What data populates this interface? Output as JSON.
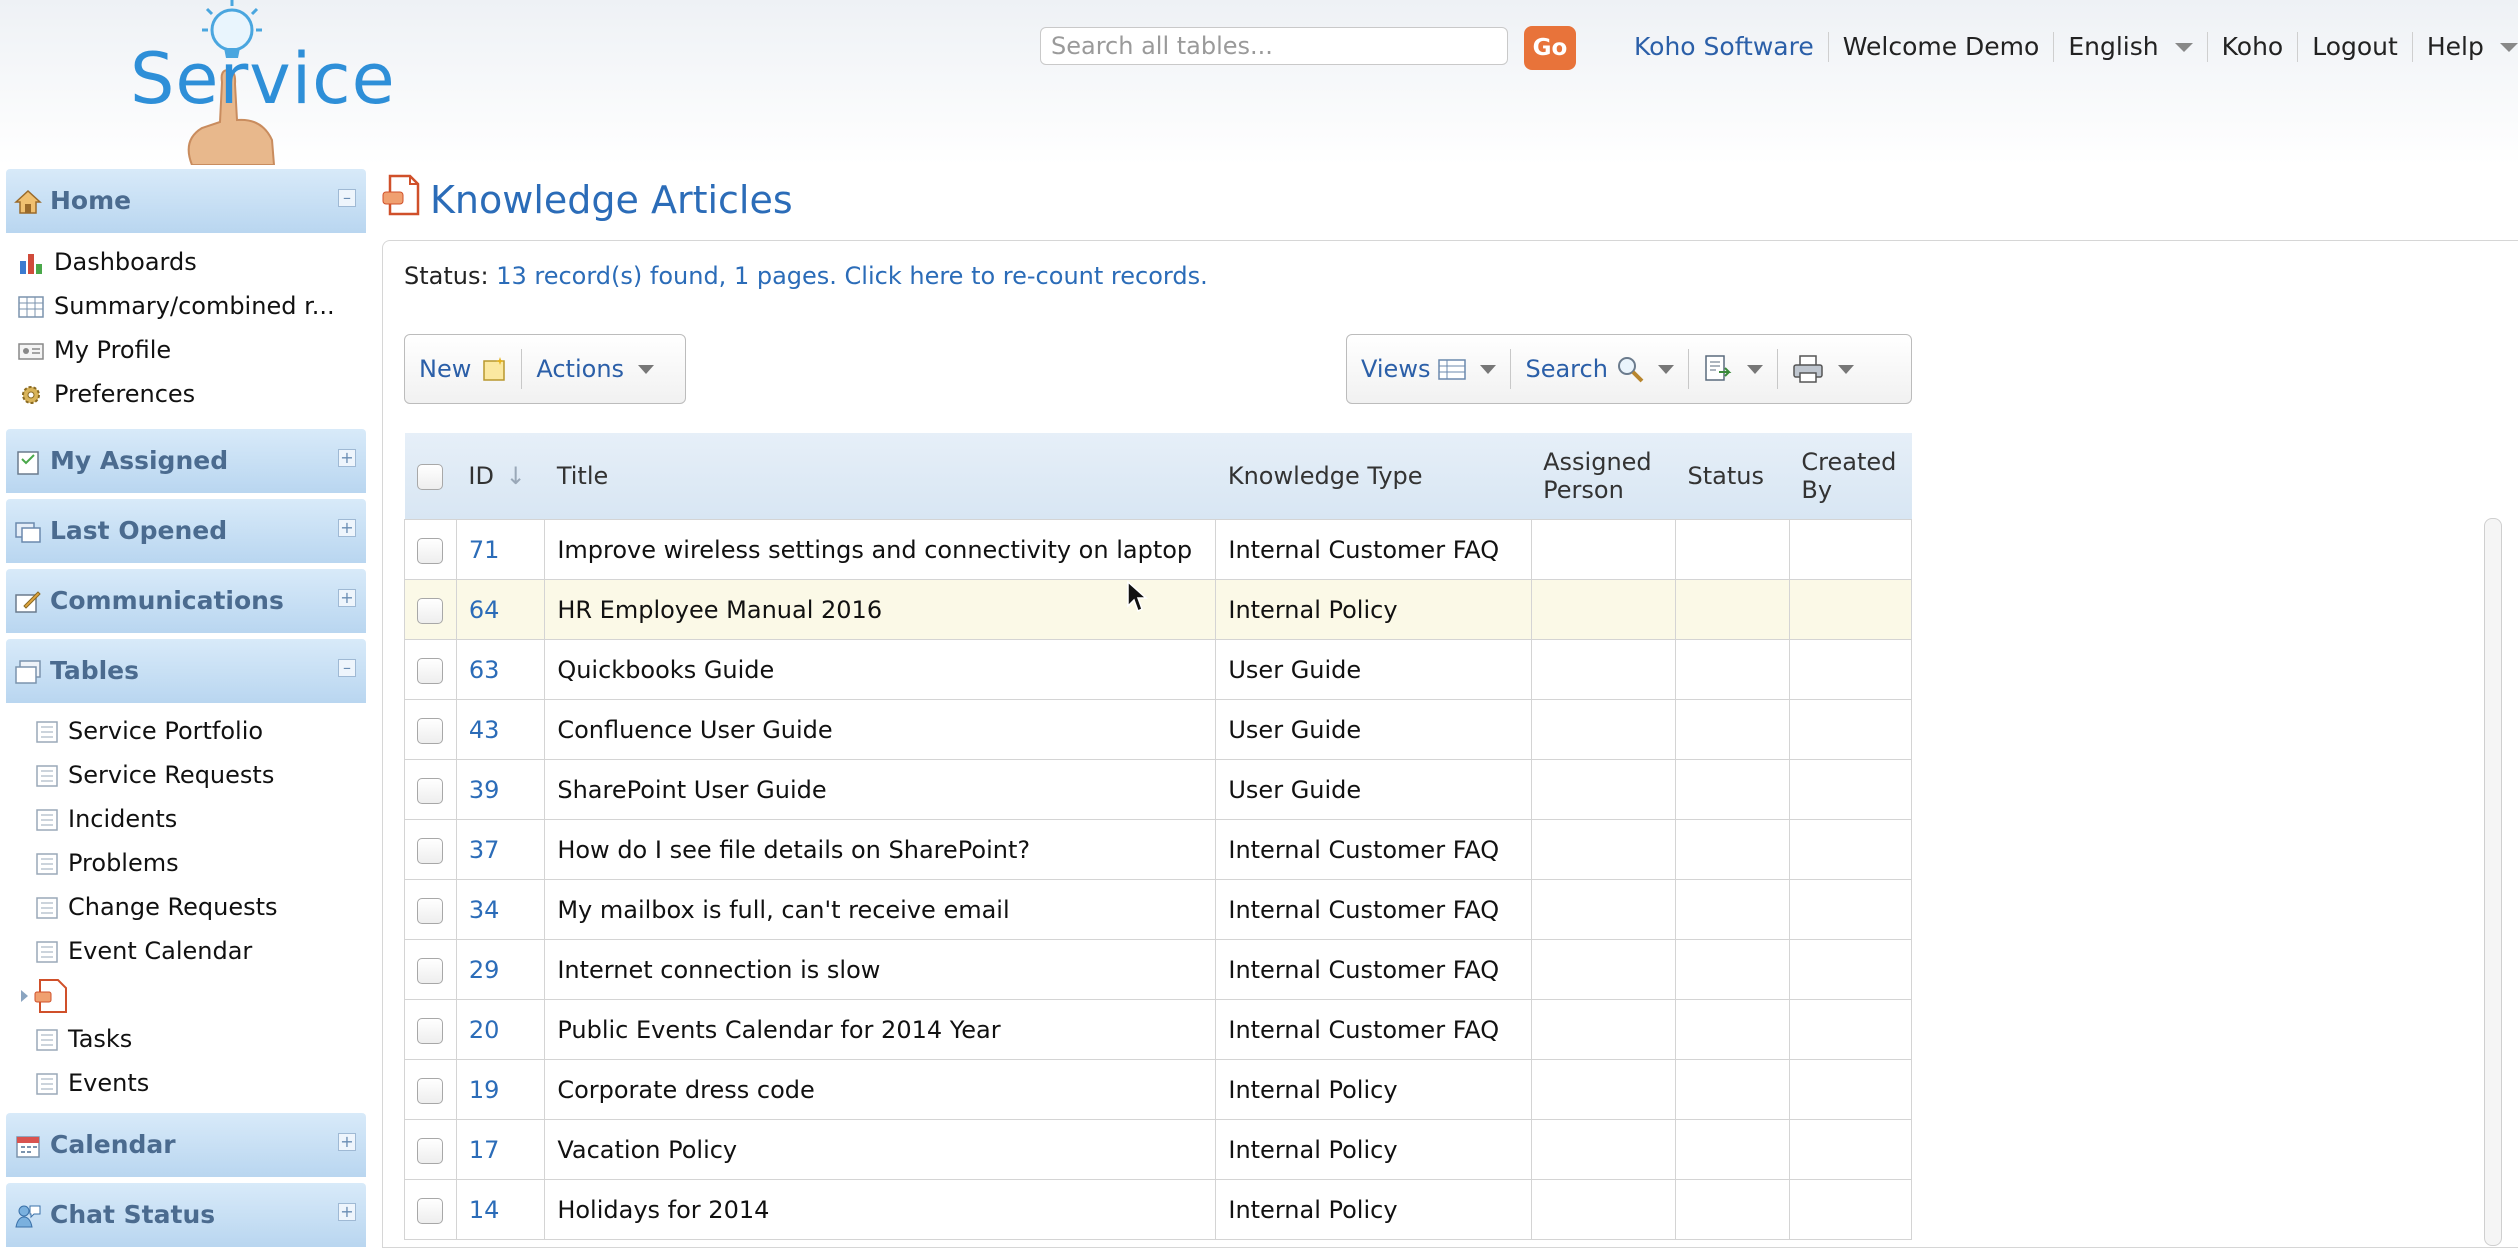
{
  "header": {
    "logo_text": "Service",
    "search_placeholder": "Search all tables...",
    "go_label": "Go",
    "nav": {
      "company": "Koho Software",
      "welcome": "Welcome Demo",
      "language": "English",
      "user": "Koho",
      "logout": "Logout",
      "help": "Help"
    }
  },
  "sidebar": {
    "home": {
      "label": "Home",
      "items": [
        "Dashboards",
        "Summary/combined r...",
        "My Profile",
        "Preferences"
      ]
    },
    "my_assigned": "My Assigned",
    "last_opened": "Last Opened",
    "communications": "Communications",
    "tables": {
      "label": "Tables",
      "items": [
        "Service Portfolio",
        "Service Requests",
        "Incidents",
        "Problems",
        "Change Requests",
        "Event Calendar",
        "Tasks",
        "Events"
      ]
    },
    "calendar": "Calendar",
    "chat_status": "Chat Status"
  },
  "main": {
    "title": "Knowledge Articles",
    "status_label": "Status:",
    "status_text": "13 record(s) found, 1 pages. Click here to re-count records.",
    "toolbar": {
      "new_label": "New",
      "actions_label": "Actions",
      "views_label": "Views",
      "search_label": "Search"
    },
    "table": {
      "headers": {
        "id": "ID",
        "id_sort": "↓",
        "title": "Title",
        "type": "Knowledge Type",
        "assigned_1": "Assigned",
        "assigned_2": "Person",
        "status": "Status",
        "created_1": "Created",
        "created_2": "By"
      },
      "rows": [
        {
          "id": "71",
          "title": "Improve wireless settings and connectivity on laptop",
          "type": "Internal Customer FAQ"
        },
        {
          "id": "64",
          "title": "HR Employee Manual 2016",
          "type": "Internal Policy"
        },
        {
          "id": "63",
          "title": "Quickbooks Guide",
          "type": "User Guide"
        },
        {
          "id": "43",
          "title": "Confluence User Guide",
          "type": "User Guide"
        },
        {
          "id": "39",
          "title": "SharePoint User Guide",
          "type": "User Guide"
        },
        {
          "id": "37",
          "title": "How do I see file details on SharePoint?",
          "type": "Internal Customer FAQ"
        },
        {
          "id": "34",
          "title": "My mailbox is full, can't receive email",
          "type": "Internal Customer FAQ"
        },
        {
          "id": "29",
          "title": "Internet connection is slow",
          "type": "Internal Customer FAQ"
        },
        {
          "id": "20",
          "title": "Public Events Calendar for 2014 Year",
          "type": "Internal Customer FAQ"
        },
        {
          "id": "19",
          "title": "Corporate dress code",
          "type": "Internal Policy"
        },
        {
          "id": "17",
          "title": "Vacation Policy",
          "type": "Internal Policy"
        },
        {
          "id": "14",
          "title": "Holidays for 2014",
          "type": "Internal Policy"
        }
      ]
    }
  },
  "colors": {
    "accent_blue": "#2b6cb8",
    "go_orange": "#e8733a",
    "section_blue": "#b9d6f0",
    "row_highlight": "#fbf9e7"
  }
}
